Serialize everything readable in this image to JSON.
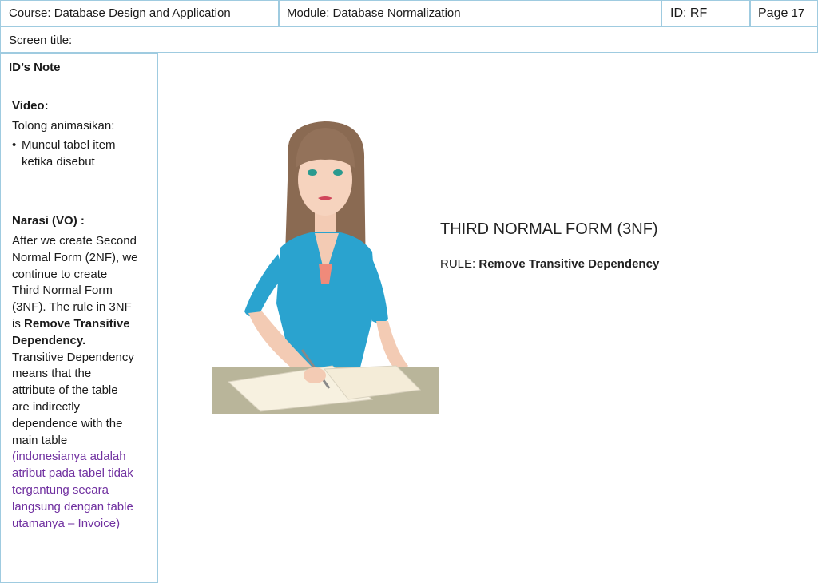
{
  "header": {
    "course": "Course:  Database Design and Application",
    "module": "Module: Database Normalization",
    "id": "ID: RF",
    "page_prefix": "Page",
    "page_number": "17"
  },
  "screen_title_label": "Screen title:",
  "notes": {
    "heading": "ID’s Note",
    "video_label": "Video:",
    "video_intro": "Tolong animasikan:",
    "video_bullet_line1": "Muncul tabel item",
    "video_bullet_line2": "ketika disebut",
    "narasi_label": "Narasi (VO) :",
    "narasi_lines": [
      "After we create Second",
      "Normal Form (2NF), we",
      "continue to create",
      "Third Normal Form",
      "(3NF). The rule in 3NF"
    ],
    "narasi_is": "is ",
    "narasi_bold1": "Remove Transitive",
    "narasi_bold2": "Dependency.",
    "narasi_lines2": [
      "Transitive Dependency",
      "means that the",
      "attribute of the table",
      "are indirectly",
      "dependence with the",
      "main table"
    ],
    "indonesian_lines": [
      "(indonesianya adalah",
      "atribut pada tabel tidak",
      "tergantung secara",
      "langsung dengan table",
      "utamanya – Invoice)"
    ]
  },
  "slide": {
    "title": "THIRD NORMAL FORM (3NF)",
    "rule_label": "RULE: ",
    "rule_value": "Remove Transitive Dependency"
  },
  "colors": {
    "border": "#9fcbe0",
    "purple": "#7030a0",
    "shirt": "#2aa3cf",
    "hair": "#8a6a52",
    "desk": "#b9b59a"
  }
}
